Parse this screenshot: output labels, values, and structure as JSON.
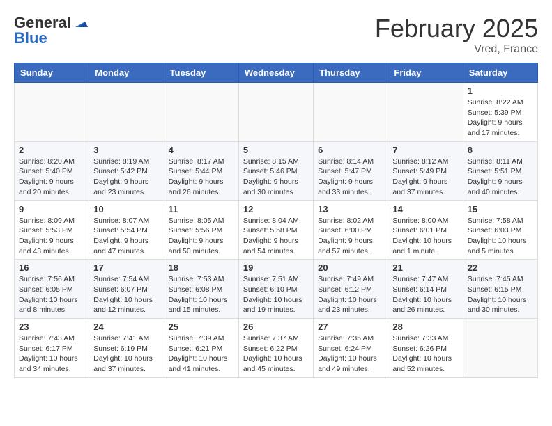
{
  "header": {
    "logo_line1": "General",
    "logo_line2": "Blue",
    "month_title": "February 2025",
    "location": "Vred, France"
  },
  "weekdays": [
    "Sunday",
    "Monday",
    "Tuesday",
    "Wednesday",
    "Thursday",
    "Friday",
    "Saturday"
  ],
  "weeks": [
    [
      {
        "day": "",
        "info": ""
      },
      {
        "day": "",
        "info": ""
      },
      {
        "day": "",
        "info": ""
      },
      {
        "day": "",
        "info": ""
      },
      {
        "day": "",
        "info": ""
      },
      {
        "day": "",
        "info": ""
      },
      {
        "day": "1",
        "info": "Sunrise: 8:22 AM\nSunset: 5:39 PM\nDaylight: 9 hours and 17 minutes."
      }
    ],
    [
      {
        "day": "2",
        "info": "Sunrise: 8:20 AM\nSunset: 5:40 PM\nDaylight: 9 hours and 20 minutes."
      },
      {
        "day": "3",
        "info": "Sunrise: 8:19 AM\nSunset: 5:42 PM\nDaylight: 9 hours and 23 minutes."
      },
      {
        "day": "4",
        "info": "Sunrise: 8:17 AM\nSunset: 5:44 PM\nDaylight: 9 hours and 26 minutes."
      },
      {
        "day": "5",
        "info": "Sunrise: 8:15 AM\nSunset: 5:46 PM\nDaylight: 9 hours and 30 minutes."
      },
      {
        "day": "6",
        "info": "Sunrise: 8:14 AM\nSunset: 5:47 PM\nDaylight: 9 hours and 33 minutes."
      },
      {
        "day": "7",
        "info": "Sunrise: 8:12 AM\nSunset: 5:49 PM\nDaylight: 9 hours and 37 minutes."
      },
      {
        "day": "8",
        "info": "Sunrise: 8:11 AM\nSunset: 5:51 PM\nDaylight: 9 hours and 40 minutes."
      }
    ],
    [
      {
        "day": "9",
        "info": "Sunrise: 8:09 AM\nSunset: 5:53 PM\nDaylight: 9 hours and 43 minutes."
      },
      {
        "day": "10",
        "info": "Sunrise: 8:07 AM\nSunset: 5:54 PM\nDaylight: 9 hours and 47 minutes."
      },
      {
        "day": "11",
        "info": "Sunrise: 8:05 AM\nSunset: 5:56 PM\nDaylight: 9 hours and 50 minutes."
      },
      {
        "day": "12",
        "info": "Sunrise: 8:04 AM\nSunset: 5:58 PM\nDaylight: 9 hours and 54 minutes."
      },
      {
        "day": "13",
        "info": "Sunrise: 8:02 AM\nSunset: 6:00 PM\nDaylight: 9 hours and 57 minutes."
      },
      {
        "day": "14",
        "info": "Sunrise: 8:00 AM\nSunset: 6:01 PM\nDaylight: 10 hours and 1 minute."
      },
      {
        "day": "15",
        "info": "Sunrise: 7:58 AM\nSunset: 6:03 PM\nDaylight: 10 hours and 5 minutes."
      }
    ],
    [
      {
        "day": "16",
        "info": "Sunrise: 7:56 AM\nSunset: 6:05 PM\nDaylight: 10 hours and 8 minutes."
      },
      {
        "day": "17",
        "info": "Sunrise: 7:54 AM\nSunset: 6:07 PM\nDaylight: 10 hours and 12 minutes."
      },
      {
        "day": "18",
        "info": "Sunrise: 7:53 AM\nSunset: 6:08 PM\nDaylight: 10 hours and 15 minutes."
      },
      {
        "day": "19",
        "info": "Sunrise: 7:51 AM\nSunset: 6:10 PM\nDaylight: 10 hours and 19 minutes."
      },
      {
        "day": "20",
        "info": "Sunrise: 7:49 AM\nSunset: 6:12 PM\nDaylight: 10 hours and 23 minutes."
      },
      {
        "day": "21",
        "info": "Sunrise: 7:47 AM\nSunset: 6:14 PM\nDaylight: 10 hours and 26 minutes."
      },
      {
        "day": "22",
        "info": "Sunrise: 7:45 AM\nSunset: 6:15 PM\nDaylight: 10 hours and 30 minutes."
      }
    ],
    [
      {
        "day": "23",
        "info": "Sunrise: 7:43 AM\nSunset: 6:17 PM\nDaylight: 10 hours and 34 minutes."
      },
      {
        "day": "24",
        "info": "Sunrise: 7:41 AM\nSunset: 6:19 PM\nDaylight: 10 hours and 37 minutes."
      },
      {
        "day": "25",
        "info": "Sunrise: 7:39 AM\nSunset: 6:21 PM\nDaylight: 10 hours and 41 minutes."
      },
      {
        "day": "26",
        "info": "Sunrise: 7:37 AM\nSunset: 6:22 PM\nDaylight: 10 hours and 45 minutes."
      },
      {
        "day": "27",
        "info": "Sunrise: 7:35 AM\nSunset: 6:24 PM\nDaylight: 10 hours and 49 minutes."
      },
      {
        "day": "28",
        "info": "Sunrise: 7:33 AM\nSunset: 6:26 PM\nDaylight: 10 hours and 52 minutes."
      },
      {
        "day": "",
        "info": ""
      }
    ]
  ]
}
